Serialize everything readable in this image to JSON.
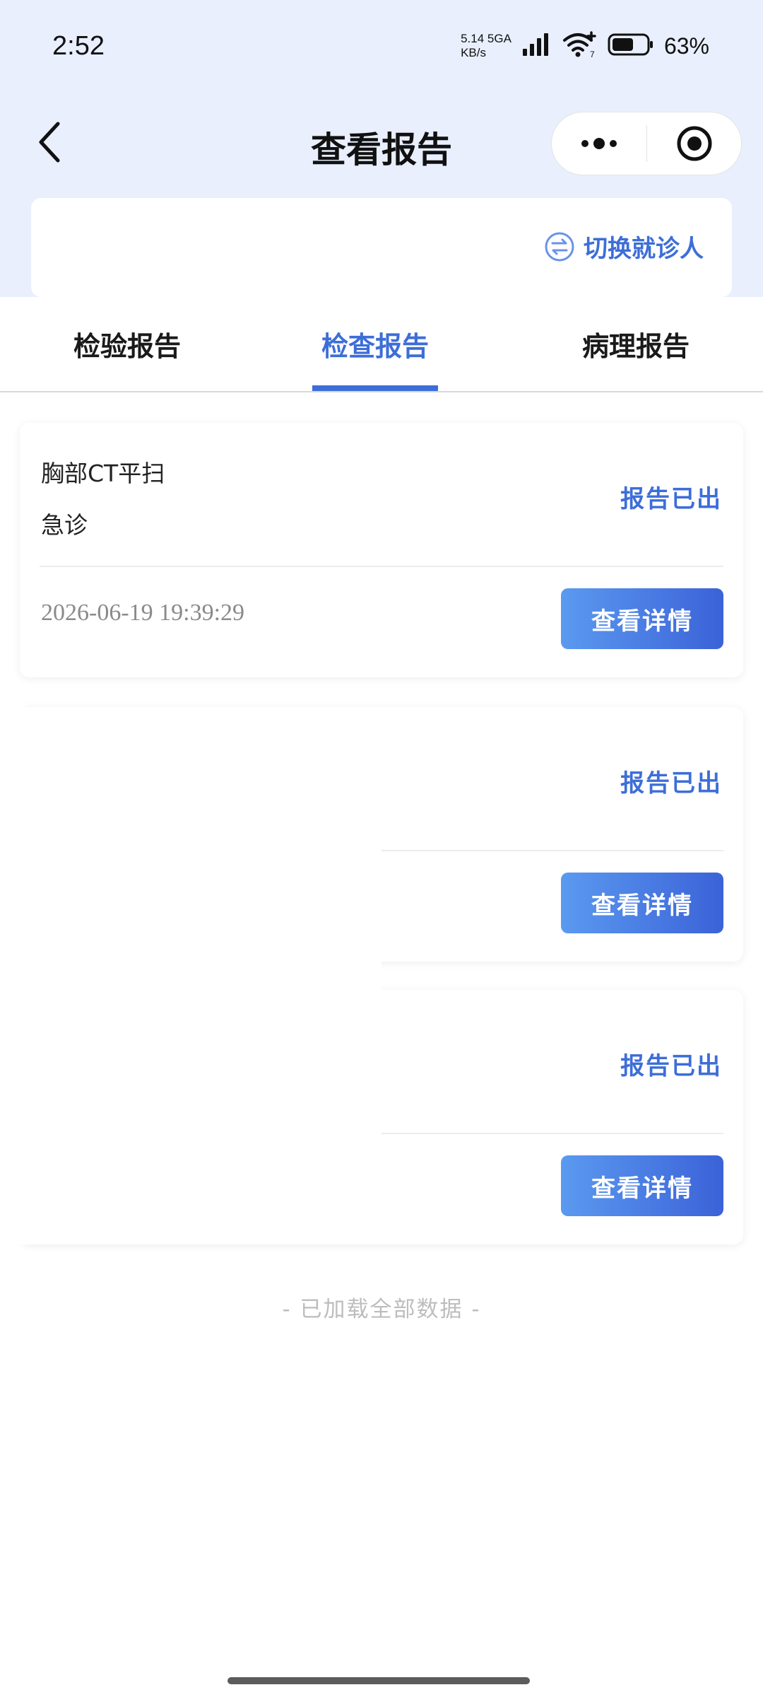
{
  "status_bar": {
    "time": "2:52",
    "net_speed_value": "5.14",
    "net_speed_unit": "KB/s",
    "network_type": "5GA",
    "wifi_badge": "7",
    "battery_percent": "63%",
    "battery_level": 0.63
  },
  "nav": {
    "title": "查看报告"
  },
  "patient_card": {
    "switch_label": "切换就诊人"
  },
  "tabs": [
    {
      "label": "检验报告",
      "active": false
    },
    {
      "label": "检查报告",
      "active": true
    },
    {
      "label": "病理报告",
      "active": false
    }
  ],
  "reports": [
    {
      "name": "胸部CT平扫",
      "dept": "急诊",
      "status": "报告已出",
      "time": "2026-06-19  19:39:29",
      "button": "查看详情"
    },
    {
      "name": "",
      "dept": "",
      "status": "报告已出",
      "time": "",
      "button": "查看详情"
    },
    {
      "name": "",
      "dept": "",
      "status": "报告已出",
      "time": "",
      "button": "查看详情"
    }
  ],
  "footer": {
    "note": "- 已加载全部数据 -"
  },
  "colors": {
    "accent": "#3d6ed8",
    "header_bg": "#e9effd",
    "button_gradient_start": "#5b9af0",
    "button_gradient_end": "#3b62d8"
  }
}
